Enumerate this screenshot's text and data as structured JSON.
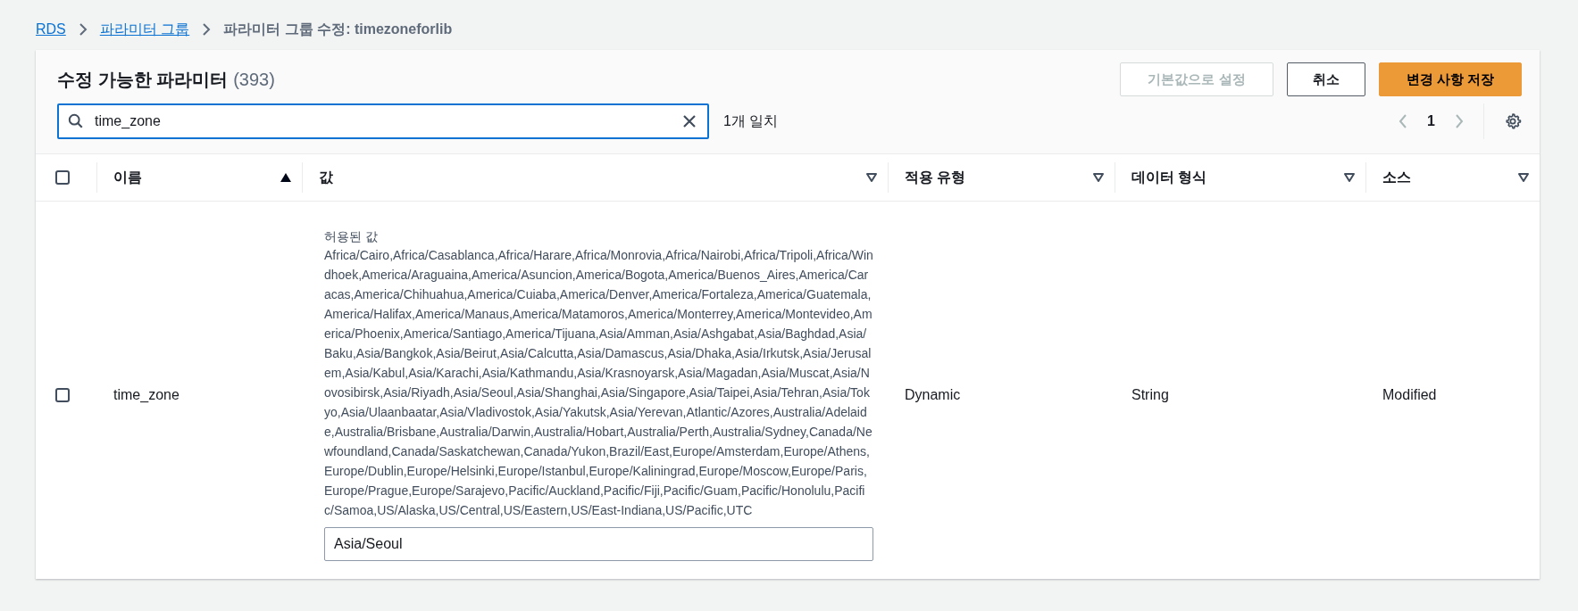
{
  "breadcrumb": [
    {
      "label": "RDS",
      "kind": "link"
    },
    {
      "label": "파라미터 그룹",
      "kind": "link"
    },
    {
      "label": "파라미터 그룹 수정: timezoneforlib",
      "kind": "current"
    }
  ],
  "panel": {
    "title": "수정 가능한 파라미터",
    "count": "(393)",
    "buttons": [
      {
        "label": "기본값으로 설정",
        "kind": "normal",
        "disabled": true
      },
      {
        "label": "취소",
        "kind": "normal",
        "disabled": false
      },
      {
        "label": "변경 사항 저장",
        "kind": "primary",
        "disabled": false
      }
    ],
    "search": {
      "value": "time_zone",
      "matches": "1개 일치"
    },
    "pagination": {
      "page": "1",
      "prev_disabled": true,
      "next_disabled": true
    }
  },
  "table": {
    "columns": [
      {
        "label": "이름",
        "sorted_ascending": true
      },
      {
        "label": "값",
        "sorted_ascending": false
      },
      {
        "label": "적용 유형",
        "sorted_ascending": false
      },
      {
        "label": "데이터 형식",
        "sorted_ascending": false
      },
      {
        "label": "소스",
        "sorted_ascending": false
      }
    ],
    "select_all_checked": false,
    "rows": [
      {
        "checked": false,
        "name": "time_zone",
        "allowed_label": "허용된 값",
        "allowed_values": "Africa/Cairo,Africa/Casablanca,Africa/Harare,Africa/Monrovia,Africa/Nairobi,Africa/Tripoli,Africa/Windhoek,America/Araguaina,America/Asuncion,America/Bogota,America/Buenos_Aires,America/Caracas,America/Chihuahua,America/Cuiaba,America/Denver,America/Fortaleza,America/Guatemala,America/Halifax,America/Manaus,America/Matamoros,America/Monterrey,America/Montevideo,America/Phoenix,America/Santiago,America/Tijuana,Asia/Amman,Asia/Ashgabat,Asia/Baghdad,Asia/Baku,Asia/Bangkok,Asia/Beirut,Asia/Calcutta,Asia/Damascus,Asia/Dhaka,Asia/Irkutsk,Asia/Jerusalem,Asia/Kabul,Asia/Karachi,Asia/Kathmandu,Asia/Krasnoyarsk,Asia/Magadan,Asia/Muscat,Asia/Novosibirsk,Asia/Riyadh,Asia/Seoul,Asia/Shanghai,Asia/Singapore,Asia/Taipei,Asia/Tehran,Asia/Tokyo,Asia/Ulaanbaatar,Asia/Vladivostok,Asia/Yakutsk,Asia/Yerevan,Atlantic/Azores,Australia/Adelaide,Australia/Brisbane,Australia/Darwin,Australia/Hobart,Australia/Perth,Australia/Sydney,Canada/Newfoundland,Canada/Saskatchewan,Canada/Yukon,Brazil/East,Europe/Amsterdam,Europe/Athens,Europe/Dublin,Europe/Helsinki,Europe/Istanbul,Europe/Kaliningrad,Europe/Moscow,Europe/Paris,Europe/Prague,Europe/Sarajevo,Pacific/Auckland,Pacific/Fiji,Pacific/Guam,Pacific/Honolulu,Pacific/Samoa,US/Alaska,US/Central,US/Eastern,US/East-Indiana,US/Pacific,UTC",
        "value": "Asia/Seoul",
        "apply_type": "Dynamic",
        "data_type": "String",
        "source": "Modified"
      }
    ]
  }
}
